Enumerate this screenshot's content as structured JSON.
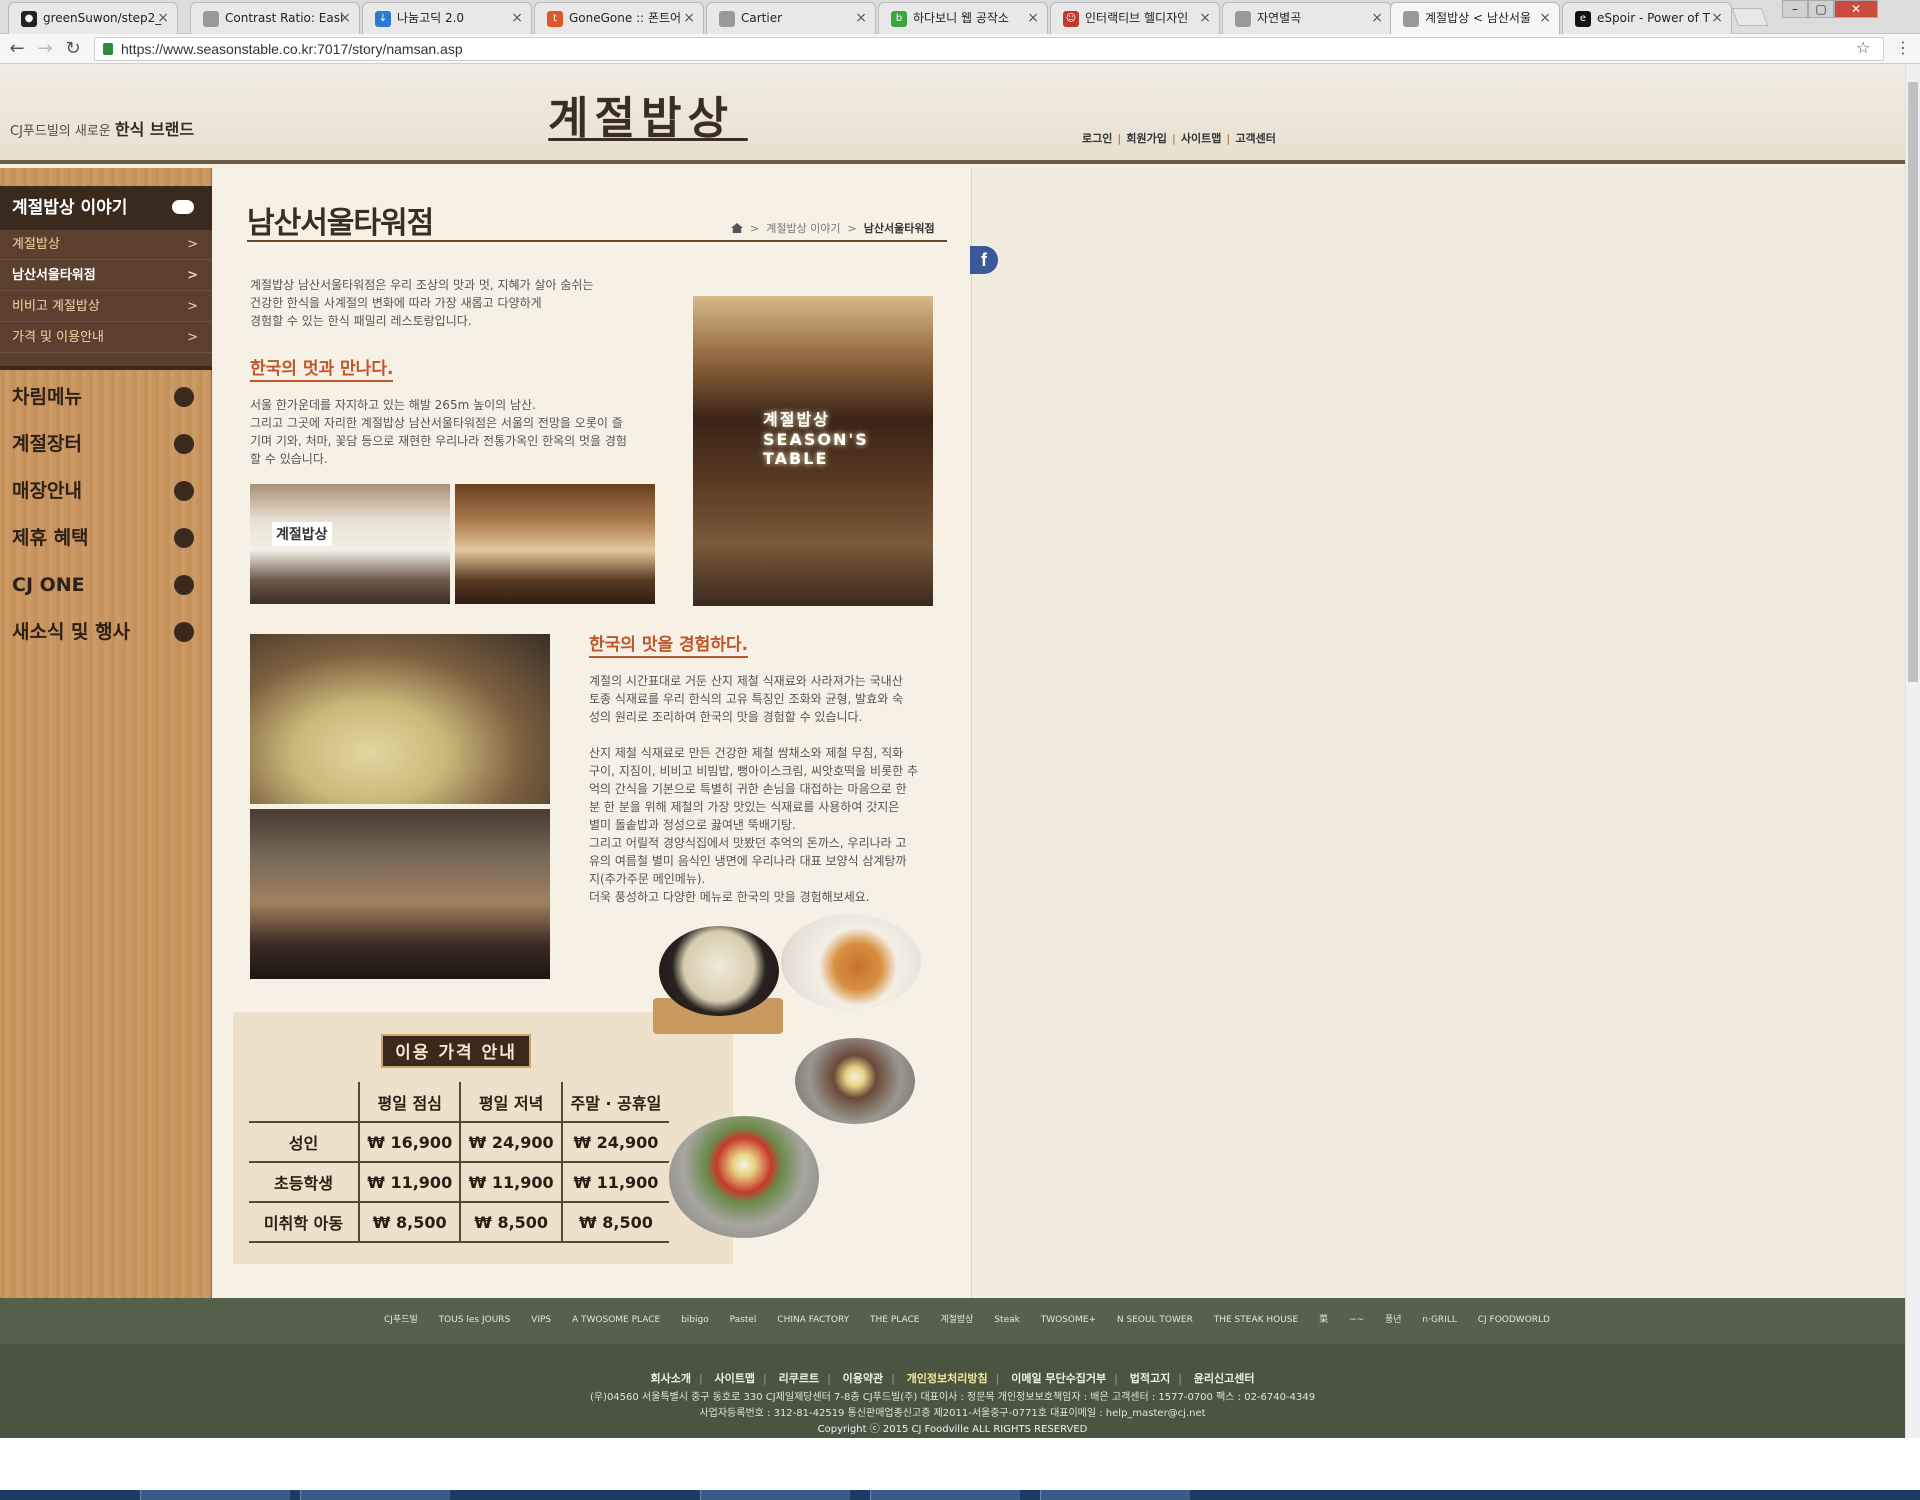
{
  "browser": {
    "tabs": [
      {
        "title": "greenSuwon/step2_"
      },
      {
        "title": "Contrast Ratio: Easi"
      },
      {
        "title": "나눔고딕 2.0"
      },
      {
        "title": "GoneGone :: 폰트어"
      },
      {
        "title": "Cartier"
      },
      {
        "title": "하다보니 웹 공작소"
      },
      {
        "title": "인터랙티브 헬디자인"
      },
      {
        "title": "자연별곡"
      },
      {
        "title": "계절밥상 < 남산서울"
      },
      {
        "title": "eSpoir - Power of T"
      }
    ],
    "url": "https://www.seasonstable.co.kr:7017/story/namsan.asp"
  },
  "header": {
    "tagline_prefix": "CJ푸드빌의 새로운",
    "tagline_brand": "한식 브랜드",
    "logo": "계절밥상",
    "util_links": [
      "로그인",
      "회원가입",
      "사이트맵",
      "고객센터"
    ]
  },
  "sidebar": {
    "section_title": "계절밥상 이야기",
    "sub_items": [
      "계절밥상",
      "남산서울타워점",
      "비비고 계절밥상",
      "가격 및 이용안내"
    ],
    "main_items": [
      "차림메뉴",
      "계절장터",
      "매장안내",
      "제휴 혜택",
      "CJ ONE",
      "새소식 및 행사"
    ]
  },
  "main": {
    "title": "남산서울타워점",
    "breadcrumb": [
      "계절밥상 이야기",
      "남산서울타워점"
    ],
    "intro": "계절밥상 남산서울타워점은 우리 조상의 맛과 멋, 지혜가 살아 숨쉬는\n건강한 한식을 사계절의 변화에 따라 가장 새롭고 다양하게\n경험할 수 있는 한식 패밀리 레스토랑입니다.",
    "section1_title": "한국의 멋과 만나다.",
    "section1_text": "서울 한가운데를 자지하고 있는 해발 265m 높이의 남산.\n그리고 그곳에 자리한 계절밥상 남산서울타워점은 서울의 전망을 오롯이 즐\n기며 기와, 처마, 꽃담 등으로 재현한 우리나라 전통가옥인 한옥의 멋을 경험\n할 수 있습니다.",
    "section2_title": "한국의 맛을 경험하다.",
    "section2_text1": "계절의 시간표대로 거둔 산지 제철 식재료와 사라져가는 국내산\n토종 식재료를 우리 한식의 고유 특징인 조화와 균형, 발효와 숙\n성의 원리로 조리하여 한국의 맛을 경험할 수 있습니다.",
    "section2_text2": "산지 제철 식재료로 만든 건강한 제철 쌈채소와 제철 무침, 직화\n구이, 지짐이, 비비고 비빔밥, 뻥아이스크림, 씨앗호떡을 비롯한 추\n억의 간식을 기본으로 특별히 귀한 손님을 대접하는 마음으로 한\n분 한 분을 위해 제철의 가장 맛있는 식재료를 사용하여 갓지은\n별미 돌솥밥과 정성으로 끓여낸 뚝배기탕.\n그리고 어릴적 경양식집에서 맛봤던 추억의 돈까스, 우리나라 고\n유의 여름철 별미 음식인 냉면에 우리나라 대표 보양식 삼계탕까\n지(추가주문 메인메뉴).\n더욱 풍성하고 다양한 메뉴로 한국의 맛을 경험해보세요.",
    "sign_text": "계절밥상 SEASON'S TABLE",
    "entrance_sign": "계절밥상"
  },
  "price": {
    "title": "이용 가격 안내",
    "headers": [
      "",
      "평일 점심",
      "평일 저녁",
      "주말 · 공휴일"
    ],
    "rows": [
      [
        "성인",
        "₩ 16,900",
        "₩ 24,900",
        "₩ 24,900"
      ],
      [
        "초등학생",
        "₩ 11,900",
        "₩ 11,900",
        "₩ 11,900"
      ],
      [
        "미취학 아동",
        "₩ 8,500",
        "₩ 8,500",
        "₩ 8,500"
      ]
    ]
  },
  "partners": [
    "CJ푸드빌",
    "TOUS les JOURS",
    "VIPS",
    "A TWOSOME PLACE",
    "bibigo",
    "Pastel",
    "CHINA FACTORY",
    "THE PLACE",
    "계절밥상",
    "Steak",
    "TWOSOME+",
    "N SEOUL TOWER",
    "THE STEAK HOUSE",
    "菜",
    "~~",
    "풍년",
    "n·GRILL",
    "CJ FOODWORLD"
  ],
  "footer": {
    "links": [
      "회사소개",
      "사이트맵",
      "리쿠르트",
      "이용약관",
      "개인정보처리방침",
      "이메일 무단수집거부",
      "법적고지",
      "윤리신고센터"
    ],
    "address": "(우)04560 서울특별시 중구 동호로 330 CJ제일제당센터 7-8층 CJ푸드빌(주)   대표이사 : 정문목   개인정보보호책임자 : 배은   고객센터 : 1577-0700   팩스 : 02-6740-4349",
    "registration": "사업자등록번호 : 312-81-42519   통신판매업종신고증 제2011-서울중구-0771호   대표이메일 : help_master@cj.net",
    "copyright": "Copyright ⓒ 2015 CJ Foodville ALL RIGHTS RESERVED"
  }
}
